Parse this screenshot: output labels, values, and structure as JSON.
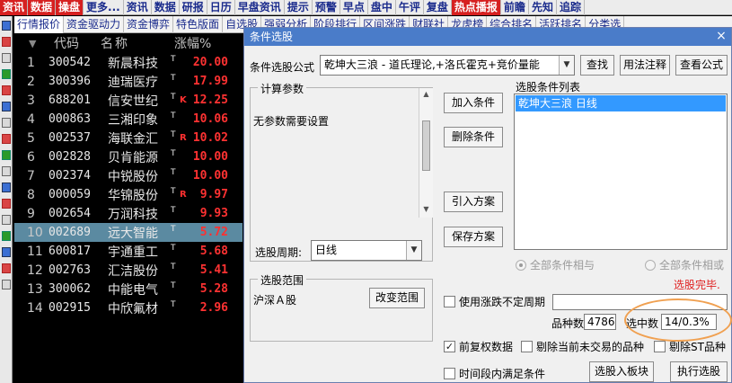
{
  "topmenu": [
    "资讯",
    "数据",
    "操盘",
    "更多...",
    "资讯",
    "数据",
    "研报",
    "日历",
    "早盘资讯",
    "提示",
    "预警",
    "早点",
    "盘中",
    "午评",
    "复盘",
    "热点播报",
    "前瞻",
    "先知",
    "追踪"
  ],
  "tabs": [
    "行情报价",
    "资金驱动力",
    "资金博弈",
    "特色版面",
    "自选股",
    "强弱分析",
    "阶段排行",
    "区间涨跌",
    "财联社",
    "龙虎榜",
    "综合排名",
    "活跃排名",
    "分类选"
  ],
  "list": {
    "headers": {
      "code": "代码",
      "name": "称",
      "name_prefix": "名",
      "pct": "涨幅%",
      "arrow": "▼"
    },
    "rows": [
      {
        "idx": "1",
        "code": "300542",
        "name": "新晨科技",
        "t": "T",
        "mark": "",
        "pct": "20.00"
      },
      {
        "idx": "2",
        "code": "300396",
        "name": "迪瑞医疗",
        "t": "T",
        "mark": "",
        "pct": "17.99"
      },
      {
        "idx": "3",
        "code": "688201",
        "name": "信安世纪",
        "t": "T",
        "mark": "K",
        "pct": "12.25"
      },
      {
        "idx": "4",
        "code": "000863",
        "name": "三湘印象",
        "t": "T",
        "mark": "",
        "pct": "10.06"
      },
      {
        "idx": "5",
        "code": "002537",
        "name": "海联金汇",
        "t": "T",
        "mark": "R",
        "pct": "10.02"
      },
      {
        "idx": "6",
        "code": "002828",
        "name": "贝肯能源",
        "t": "T",
        "mark": "",
        "pct": "10.00"
      },
      {
        "idx": "7",
        "code": "002374",
        "name": "中锐股份",
        "t": "T",
        "mark": "",
        "pct": "10.00"
      },
      {
        "idx": "8",
        "code": "000059",
        "name": "华锦股份",
        "t": "T",
        "mark": "R",
        "pct": "9.97"
      },
      {
        "idx": "9",
        "code": "002654",
        "name": "万润科技",
        "t": "T",
        "mark": "",
        "pct": "9.93"
      },
      {
        "idx": "10",
        "code": "002689",
        "name": "远大智能",
        "t": "T",
        "mark": "",
        "pct": "5.72"
      },
      {
        "idx": "11",
        "code": "600817",
        "name": "宇通重工",
        "t": "T",
        "mark": "",
        "pct": "5.68"
      },
      {
        "idx": "12",
        "code": "002763",
        "name": "汇洁股份",
        "t": "T",
        "mark": "",
        "pct": "5.41"
      },
      {
        "idx": "13",
        "code": "300062",
        "name": "中能电气",
        "t": "T",
        "mark": "",
        "pct": "5.28"
      },
      {
        "idx": "14",
        "code": "002915",
        "name": "中欣氟材",
        "t": "T",
        "mark": "",
        "pct": "2.96"
      }
    ]
  },
  "dialog": {
    "title": "条件选股",
    "formula_label": "条件选股公式",
    "formula_value": "乾坤大三浪  - 道氏理论,+洛氏霍克+竞价量能",
    "find": "查找",
    "usage": "用法注释",
    "view_formula": "查看公式",
    "calc_params": "计算参数",
    "no_params": "无参数需要设置",
    "add_cond": "加入条件",
    "del_cond": "删除条件",
    "import_plan": "引入方案",
    "save_plan": "保存方案",
    "cond_list_title": "选股条件列表",
    "cond_list_item": "乾坤大三浪  日线",
    "period_label": "选股周期:",
    "period_value": "日线",
    "all_and": "全部条件相与",
    "all_or": "全部条件相或",
    "done_text": "选股完毕.",
    "range_title": "选股范围",
    "range_value": "沪深Ａ股",
    "change_range": "改变范围",
    "use_period": "使用涨跌不定周期",
    "count_label": "品种数",
    "count_value": "4786",
    "selected_label": "选中数",
    "selected_value": "14/0.3%",
    "fq": "前复权数据",
    "exclude_notrade": "剔除当前未交易的品种",
    "exclude_st": "剔除ST品种",
    "period_satisfy": "时间段内满足条件",
    "to_block": "选股入板块",
    "execute": "执行选股",
    "close": "×"
  }
}
